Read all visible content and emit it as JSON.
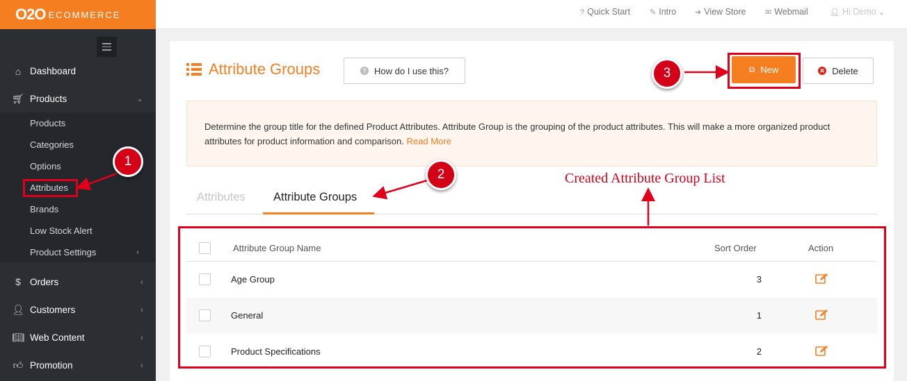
{
  "sidebar": {
    "logo_main": "O2O",
    "logo_sub": "ECOMMERCE",
    "dashboard": "Dashboard",
    "products_section": "Products",
    "sub_items": [
      "Products",
      "Categories",
      "Options",
      "Attributes",
      "Brands",
      "Low Stock Alert",
      "Product Settings"
    ],
    "lower_items": [
      "Orders",
      "Customers",
      "Web Content",
      "Promotion"
    ]
  },
  "topbar": {
    "links": [
      "Quick Start",
      "Intro",
      "View Store",
      "Webmail",
      "Hi Demo"
    ]
  },
  "page": {
    "title": "Attribute Groups",
    "help_label": "How do I use this?",
    "new_label": "New",
    "delete_label": "Delete",
    "info_text": "Determine the group title for the defined Product Attributes. Attribute Group is the grouping of the product attributes. This will make a more organized product attributes for product information and comparison.",
    "read_more": "Read More",
    "tabs": [
      "Attributes",
      "Attribute Groups"
    ]
  },
  "table": {
    "headers": [
      "Attribute Group Name",
      "Sort Order",
      "Action"
    ],
    "rows": [
      {
        "name": "Age Group",
        "sort": "3"
      },
      {
        "name": "General",
        "sort": "1"
      },
      {
        "name": "Product Specifications",
        "sort": "2"
      }
    ]
  },
  "annotations": {
    "step1": "1",
    "step2": "2",
    "step3": "3",
    "list_label": "Created Attribute Group List"
  },
  "colors": {
    "accent": "#f57e20",
    "sidebar_bg": "#2b2f33",
    "annotation_red": "#e0001b"
  }
}
